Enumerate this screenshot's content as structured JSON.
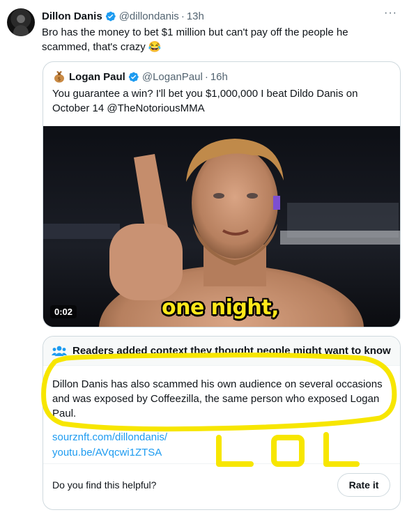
{
  "tweet": {
    "author_name": "Dillon Danis",
    "handle": "@dillondanis",
    "separator": "·",
    "time": "13h",
    "more_label": "···",
    "text": "Bro has the money to bet $1 million but can't pay off the people he scammed, that's crazy 😂"
  },
  "quote": {
    "author_name": "Logan Paul",
    "handle": "@LoganPaul",
    "separator": "·",
    "time": "16h",
    "text": "You guarantee a win? I'll bet you $1,000,000 I beat Dildo Danis on October 14 @TheNotoriousMMA",
    "video": {
      "duration": "0:02",
      "caption": "one night,"
    }
  },
  "community_note": {
    "title": "Readers added context they thought people might want to know",
    "body": "Dillon Danis has also scammed his own audience on several occasions and was exposed by Coffeezilla, the same person who exposed Logan Paul.",
    "links": [
      "sourznft.com/dillondanis/",
      "youtu.be/AVqcwi1ZTSA"
    ],
    "helpful_question": "Do you find this helpful?",
    "rate_button": "Rate it"
  },
  "annotation": {
    "scribble_text": "LOL",
    "color": "#f7e600"
  },
  "colors": {
    "text": "#0f1419",
    "secondary": "#536471",
    "link": "#1d9bf0",
    "verified": "#1d9bf0",
    "border": "#cfd9de"
  },
  "icons": [
    "verified-badge-icon",
    "more-options-icon",
    "community-notes-icon",
    "bank-bag-icon"
  ]
}
